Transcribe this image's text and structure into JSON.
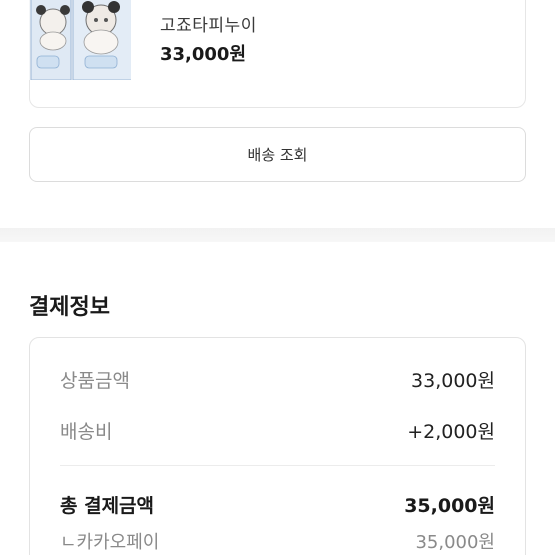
{
  "product": {
    "name": "고죠타피누이",
    "price": "33,000원"
  },
  "track_button_label": "배송 조회",
  "payment": {
    "title": "결제정보",
    "product_amount_label": "상품금액",
    "product_amount_value": "33,000원",
    "shipping_label": "배송비",
    "shipping_value": "+2,000원",
    "total_label": "총 결제금액",
    "total_value": "35,000원",
    "method_label": "ㄴ카카오페이",
    "method_value": "35,000원"
  },
  "colors": {
    "border": "#e3e3e3",
    "muted_text": "#8a8a8a",
    "strong_text": "#1a1a1a"
  }
}
